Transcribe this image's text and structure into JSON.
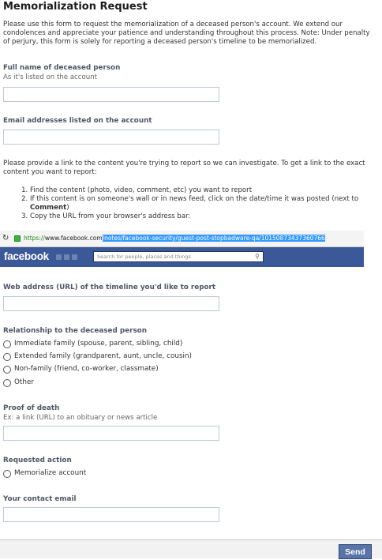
{
  "title": "Memorialization Request",
  "intro": "Please use this form to request the memorialization of a deceased person's account. We extend our condolences and appreciate your patience and understanding throughout this process. Note: Under penalty of perjury, this form is solely for reporting a deceased person's timeline to be memorialized.",
  "full_name": {
    "label": "Full name of deceased person",
    "hint": "As it's listed on the account",
    "value": ""
  },
  "emails": {
    "label": "Email addresses listed on the account",
    "value": ""
  },
  "link_help": {
    "paragraph": "Please provide a link to the content you're trying to report so we can investigate. To get a link to the exact content you want to report:",
    "steps": {
      "s1": "Find the content (photo, video, comment, etc) you want to report",
      "s2_pre": "If this content is on someone's wall or in news feed, click on the date/time it was posted (next to ",
      "s2_bold": "Comment",
      "s2_post": ")",
      "s3": "Copy the URL from your browser's address bar:"
    }
  },
  "screenshot": {
    "url_proto": "https://",
    "url_host": "www.facebook.com",
    "url_path": "/notes/facebook-security/guest-post-stopbadware-qa/10150873437360766",
    "logo": "facebook",
    "search_placeholder": "Search for people, places and things"
  },
  "timeline_url": {
    "label": "Web address (URL) of the timeline you'd like to report",
    "value": ""
  },
  "relationship": {
    "label": "Relationship to the deceased person",
    "options": {
      "o1": "Immediate family (spouse, parent, sibling, child)",
      "o2": "Extended family (grandparent, aunt, uncle, cousin)",
      "o3": "Non-family (friend, co-worker, classmate)",
      "o4": "Other"
    }
  },
  "proof": {
    "label": "Proof of death",
    "hint": "Ex: a link (URL) to an obituary or news article",
    "value": ""
  },
  "action": {
    "label": "Requested action",
    "option": "Memorialize account"
  },
  "contact": {
    "label": "Your contact email",
    "value": ""
  },
  "send_label": "Send"
}
